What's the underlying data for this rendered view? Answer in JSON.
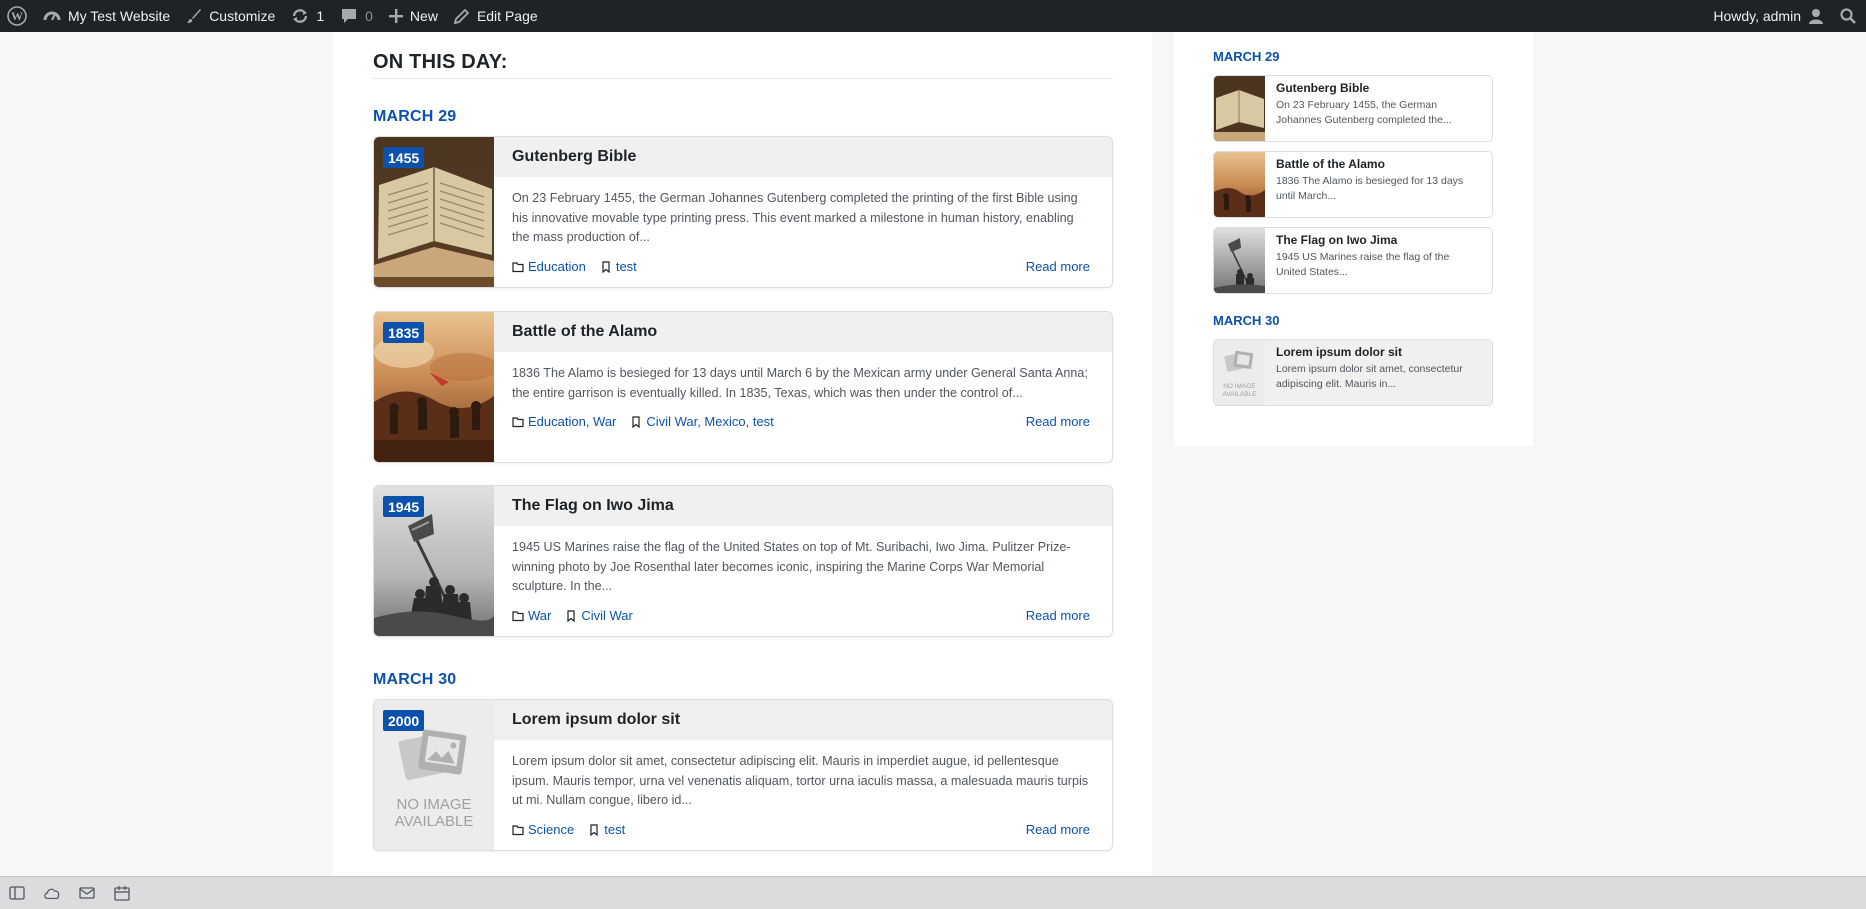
{
  "admin_bar": {
    "site_name": "My Test Website",
    "customize": "Customize",
    "updates_count": "1",
    "comments_count": "0",
    "new_label": "New",
    "edit_label": "Edit Page",
    "howdy": "Howdy, admin"
  },
  "main": {
    "section_title": "ON THIS DAY:",
    "days": [
      {
        "date": "MARCH 29",
        "events": [
          {
            "year": "1455",
            "title": "Gutenberg Bible",
            "excerpt": "On 23 February 1455, the German Johannes Gutenberg completed the printing of the first Bible using his innovative movable type printing press. This event marked a milestone in human history, enabling the mass production of...",
            "categories": "Education",
            "tags": "test",
            "read_more": "Read more"
          },
          {
            "year": "1835",
            "title": "Battle of the Alamo",
            "excerpt": "1836 The Alamo is besieged for 13 days until March 6 by the Mexican army under General Santa Anna; the entire garrison is eventually killed. In 1835, Texas, which was then under the control of...",
            "categories": "Education, War",
            "tags": "Civil War, Mexico, test",
            "read_more": "Read more"
          },
          {
            "year": "1945",
            "title": "The Flag on Iwo Jima",
            "excerpt": "1945 US Marines raise the flag of the United States on top of Mt. Suribachi, Iwo Jima. Pulitzer Prize-winning photo by Joe Rosenthal later becomes iconic, inspiring the Marine Corps War Memorial sculpture. In the...",
            "categories": "War",
            "tags": "Civil War",
            "read_more": "Read more"
          }
        ]
      },
      {
        "date": "MARCH 30",
        "events": [
          {
            "year": "2000",
            "title": "Lorem ipsum dolor sit",
            "excerpt": "Lorem ipsum dolor sit amet, consectetur adipiscing elit. Mauris in imperdiet augue, id pellentesque ipsum. Mauris tempor, urna vel venenatis aliquam, tortor urna iaculis massa, a malesuada mauris turpis ut mi. Nullam congue, libero id...",
            "categories": "Science",
            "tags": "test",
            "read_more": "Read more",
            "placeholder_line1": "NO IMAGE",
            "placeholder_line2": "AVAILABLE"
          }
        ]
      }
    ]
  },
  "sidebar": {
    "days": [
      {
        "date": "MARCH 29",
        "items": [
          {
            "title": "Gutenberg Bible",
            "excerpt": "On 23 February 1455, the German Johannes Gutenberg completed the..."
          },
          {
            "title": "Battle of the Alamo",
            "excerpt": "1836 The Alamo is besieged for 13 days until March..."
          },
          {
            "title": "The Flag on Iwo Jima",
            "excerpt": "1945 US Marines raise the flag of the United States..."
          }
        ]
      },
      {
        "date": "MARCH 30",
        "items": [
          {
            "title": "Lorem ipsum dolor sit",
            "excerpt": "Lorem ipsum dolor sit amet, consectetur adipiscing elit. Mauris in...",
            "placeholder_line1": "NO IMAGE",
            "placeholder_line2": "AVAILABLE"
          }
        ]
      }
    ]
  },
  "colors": {
    "admin_bar_bg": "#1d2327",
    "accent": "#0c52ad",
    "card_header_bg": "#f0f0f1"
  },
  "icons": {
    "admin_bar": [
      "wordpress-logo-icon",
      "dashboard-icon",
      "paintbrush-icon",
      "update-icon",
      "comment-icon",
      "plus-icon",
      "pencil-icon",
      "user-avatar-icon",
      "search-icon"
    ],
    "meta": [
      "folder-icon",
      "bookmark-icon"
    ],
    "bottom_bar": [
      "sidebar-toggle-icon",
      "cloud-icon",
      "mail-icon",
      "calendar-icon"
    ]
  }
}
